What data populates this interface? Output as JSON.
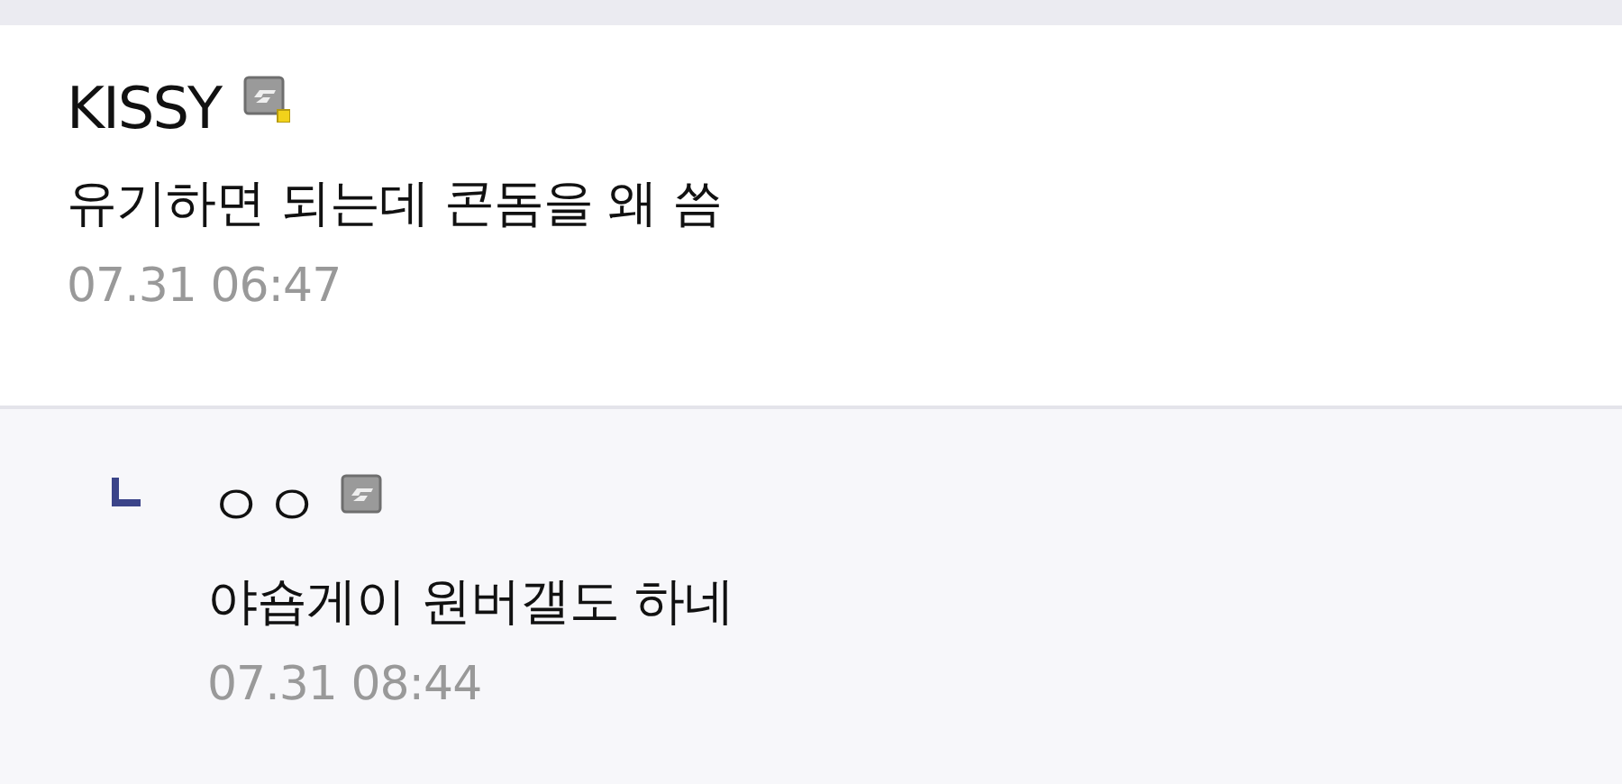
{
  "comments": [
    {
      "nickname": "KISSY",
      "badge": {
        "dot": true
      },
      "text": "유기하면 되는데 콘돔을 왜 씀",
      "time": "07.31 06:47",
      "reply": false
    },
    {
      "nickname": "ㅇㅇ",
      "badge": {
        "dot": false
      },
      "text": "야숍게이 원버갤도 하네",
      "time": "07.31 08:44",
      "reply": true
    }
  ]
}
